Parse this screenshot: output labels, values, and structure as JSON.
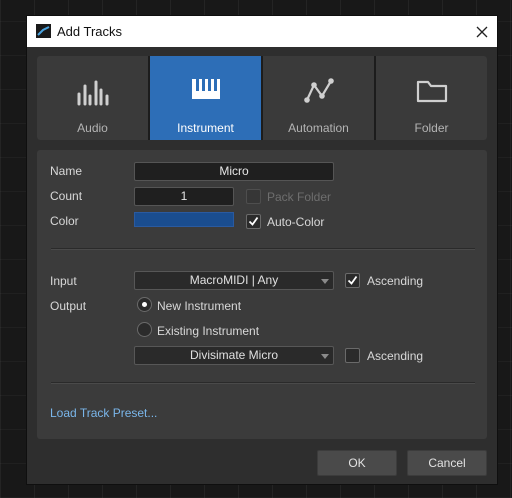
{
  "dialog": {
    "title": "Add Tracks"
  },
  "tabs": [
    {
      "label": "Audio",
      "icon": "waveform-icon"
    },
    {
      "label": "Instrument",
      "icon": "keyboard-icon",
      "active": true
    },
    {
      "label": "Automation",
      "icon": "automation-curve-icon"
    },
    {
      "label": "Folder",
      "icon": "folder-icon"
    }
  ],
  "form": {
    "name_label": "Name",
    "name_value": "Micro",
    "count_label": "Count",
    "count_value": "1",
    "pack_folder_label": "Pack Folder",
    "color_label": "Color",
    "color_value": "#1a4d8f",
    "auto_color_label": "Auto-Color",
    "input_label": "Input",
    "input_value": "MacroMIDI | Any",
    "input_ascending_label": "Ascending",
    "output_label": "Output",
    "new_instrument_label": "New Instrument",
    "existing_instrument_label": "Existing Instrument",
    "instrument_value": "Divisimate Micro",
    "output_ascending_label": "Ascending",
    "load_preset_label": "Load Track Preset..."
  },
  "buttons": {
    "ok": "OK",
    "cancel": "Cancel"
  },
  "colors": {
    "accent": "#2d6eb7",
    "link": "#7ab6ea",
    "panel": "#3b3b3b"
  }
}
